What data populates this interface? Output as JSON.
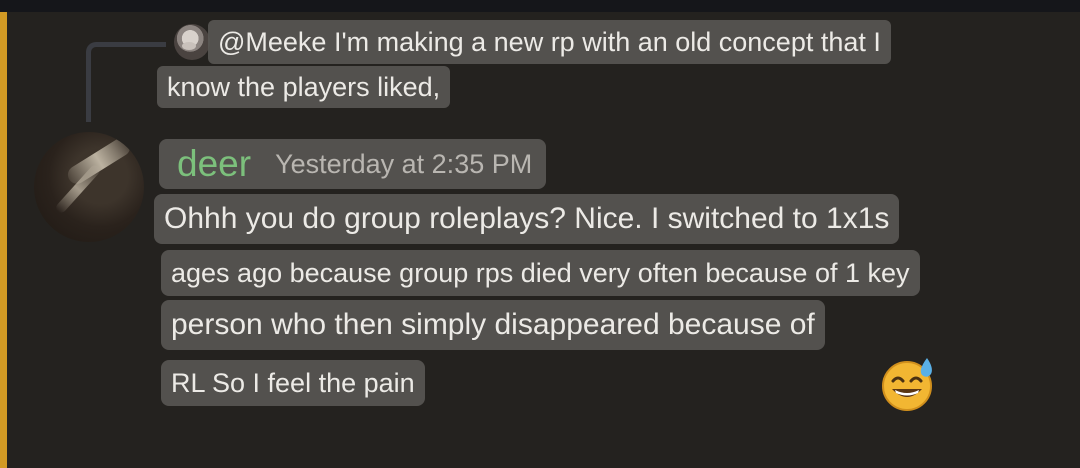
{
  "reply": {
    "avatar_icon": "user-avatar-icon",
    "text_line1": "@Meeke I'm making a new rp with an old concept that I",
    "text_line2": "know the players liked,"
  },
  "message": {
    "author": "deer",
    "author_color": "#7cc07c",
    "timestamp": "Yesterday at 2:35 PM",
    "lines": [
      "Ohhh you do group roleplays? Nice. I switched to 1x1s",
      "ages ago because group rps died very often because of 1 key",
      "person who then simply disappeared because of",
      "RL So I feel the pain"
    ],
    "emoji": "sweat-smile-emoji-icon"
  },
  "colors": {
    "mention_highlight": "#d29a24",
    "background": "#24221f",
    "text_highlight": "#585652"
  }
}
